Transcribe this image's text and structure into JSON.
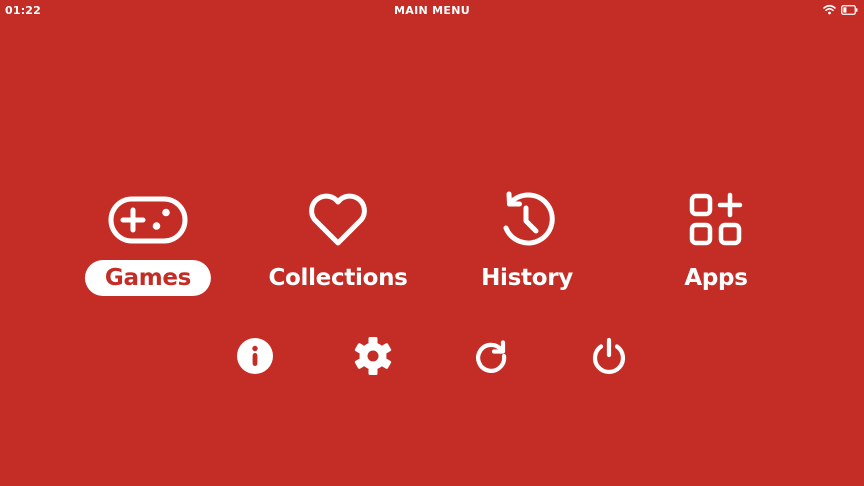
{
  "status_bar": {
    "time": "01:22",
    "title": "MAIN MENU",
    "wifi_icon": "wifi-icon",
    "battery_icon": "battery-low-icon"
  },
  "main_menu": {
    "items": [
      {
        "label": "Games",
        "icon": "gamepad-icon",
        "selected": true
      },
      {
        "label": "Collections",
        "icon": "heart-icon",
        "selected": false
      },
      {
        "label": "History",
        "icon": "history-clock-icon",
        "selected": false
      },
      {
        "label": "Apps",
        "icon": "apps-grid-icon",
        "selected": false
      }
    ]
  },
  "system_bar": {
    "buttons": [
      {
        "icon": "info-icon"
      },
      {
        "icon": "settings-gear-icon"
      },
      {
        "icon": "restart-icon"
      },
      {
        "icon": "power-icon"
      }
    ]
  },
  "colors": {
    "background": "#c32d26",
    "foreground": "#ffffff",
    "selected_text": "#c32d26"
  }
}
